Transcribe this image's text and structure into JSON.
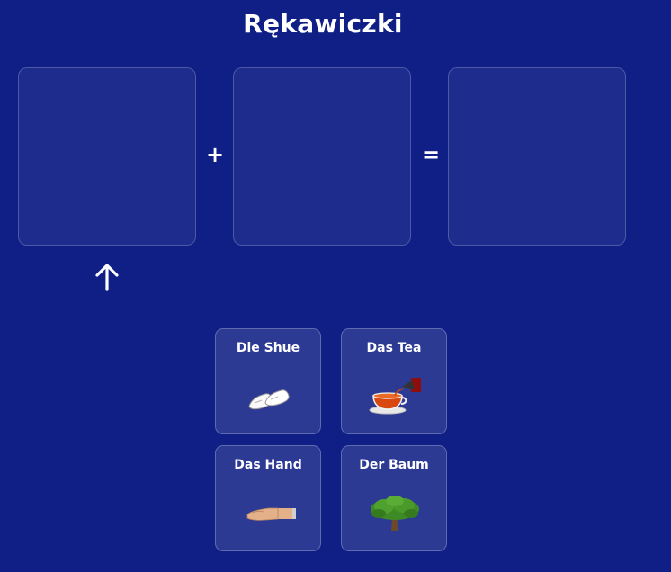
{
  "title": "Rękawiczki",
  "equation": {
    "operator_plus": "+",
    "operator_equals": "="
  },
  "arrow_icon": "arrow-up-icon",
  "cards": [
    {
      "label": "Die Shue",
      "icon": "shoes-icon"
    },
    {
      "label": "Das Tea",
      "icon": "tea-icon"
    },
    {
      "label": "Das Hand",
      "icon": "hand-icon"
    },
    {
      "label": "Der Baum",
      "icon": "tree-icon"
    }
  ],
  "colors": {
    "background": "#0f1f86",
    "tea": "#d9480f",
    "tree": "#3e8a24",
    "hand": "#e3b08a"
  }
}
